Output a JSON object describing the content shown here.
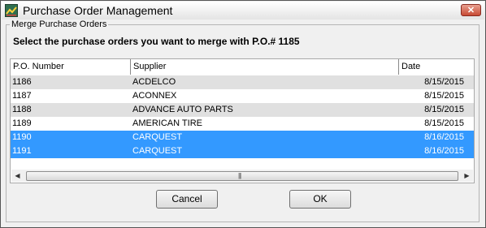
{
  "window": {
    "title": "Purchase Order Management",
    "close_symbol": "✕"
  },
  "group": {
    "legend": "Merge Purchase Orders",
    "instructions": "Select the purchase orders you want to merge with P.O.# 1185"
  },
  "table": {
    "columns": [
      "P.O. Number",
      "Supplier",
      "Date"
    ],
    "rows": [
      {
        "po": "1186",
        "supplier": "ACDELCO",
        "date": "8/15/2015",
        "selected": false
      },
      {
        "po": "1187",
        "supplier": "ACONNEX",
        "date": "8/15/2015",
        "selected": false
      },
      {
        "po": "1188",
        "supplier": "ADVANCE AUTO PARTS",
        "date": "8/15/2015",
        "selected": false
      },
      {
        "po": "1189",
        "supplier": "AMERICAN TIRE",
        "date": "8/15/2015",
        "selected": false
      },
      {
        "po": "1190",
        "supplier": "CARQUEST",
        "date": "8/16/2015",
        "selected": true
      },
      {
        "po": "1191",
        "supplier": "CARQUEST",
        "date": "8/16/2015",
        "selected": true
      }
    ]
  },
  "scrollbar": {
    "left_arrow": "◀",
    "right_arrow": "▶",
    "grip": "|||"
  },
  "buttons": {
    "cancel": "Cancel",
    "ok": "OK"
  },
  "colors": {
    "selected_bg": "#3399ff",
    "selected_text": "#ffffff",
    "alt_row_bg": "#e0e0e0",
    "row_bg": "#ffffff"
  }
}
